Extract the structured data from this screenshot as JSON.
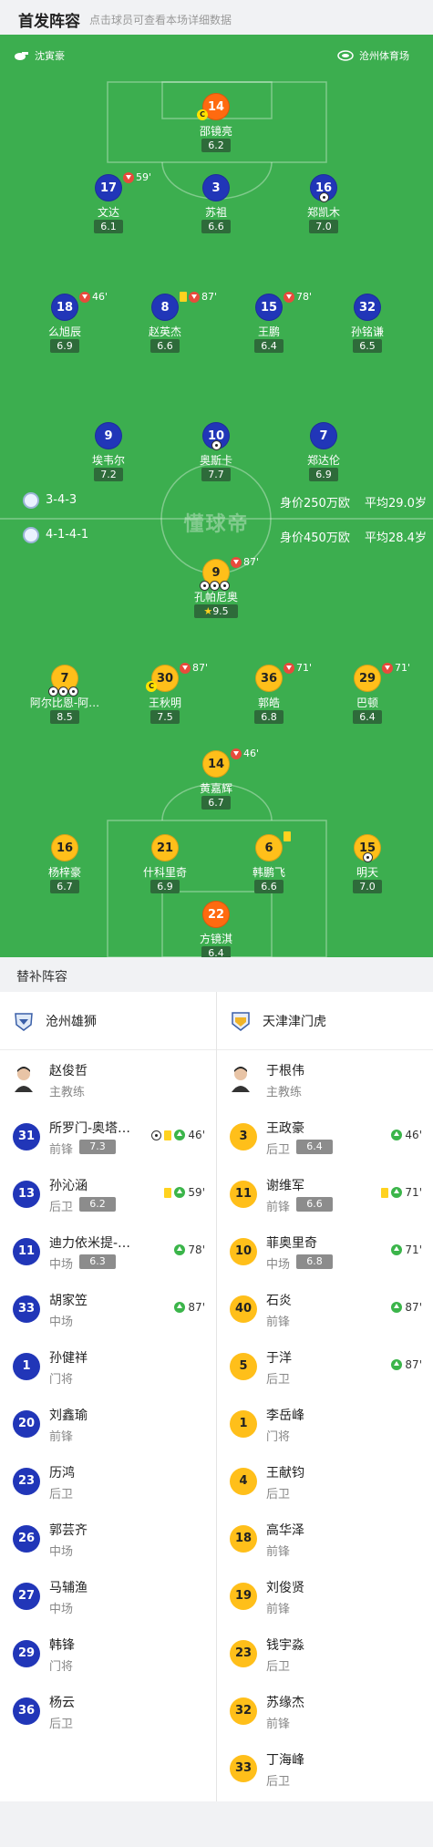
{
  "header": {
    "title": "首发阵容",
    "subtitle": "点击球员可查看本场详细数据"
  },
  "venue": {
    "referee": "沈寅豪",
    "stadium": "沧州体育场"
  },
  "watermark": "懂球帝",
  "teams_info": {
    "home": {
      "formation": "3-4-3",
      "value": "身价250万欧",
      "age": "平均29.0岁"
    },
    "away": {
      "formation": "4-1-4-1",
      "value": "身价450万欧",
      "age": "平均28.4岁"
    }
  },
  "pitch_players": [
    {
      "num": "14",
      "name": "邵镜亮",
      "rating": "6.2",
      "color": "orange",
      "captain": "C"
    },
    {
      "num": "17",
      "name": "文达",
      "rating": "6.1",
      "color": "blue",
      "sub_time": "59'"
    },
    {
      "num": "3",
      "name": "苏祖",
      "rating": "6.6",
      "color": "blue"
    },
    {
      "num": "16",
      "name": "郑凯木",
      "rating": "7.0",
      "color": "blue",
      "ball": true
    },
    {
      "num": "18",
      "name": "么旭辰",
      "rating": "6.9",
      "color": "blue",
      "sub_time": "46'"
    },
    {
      "num": "8",
      "name": "赵英杰",
      "rating": "6.6",
      "color": "blue",
      "sub_time": "87'",
      "card": true
    },
    {
      "num": "15",
      "name": "王鹏",
      "rating": "6.4",
      "color": "blue",
      "sub_time": "78'"
    },
    {
      "num": "32",
      "name": "孙铭谦",
      "rating": "6.5",
      "color": "blue"
    },
    {
      "num": "9",
      "name": "埃韦尔",
      "rating": "7.2",
      "color": "blue"
    },
    {
      "num": "10",
      "name": "奥斯卡",
      "rating": "7.7",
      "color": "blue",
      "ball": true
    },
    {
      "num": "7",
      "name": "郑达伦",
      "rating": "6.9",
      "color": "blue"
    },
    {
      "num": "9",
      "name": "孔帕尼奥",
      "rating": "9.5",
      "color": "yellow",
      "sub_time": "87'",
      "goals": 3,
      "star": true
    },
    {
      "num": "7",
      "name": "阿尔比恩-阿…",
      "rating": "8.5",
      "color": "yellow",
      "goals": 3
    },
    {
      "num": "30",
      "name": "王秋明",
      "rating": "7.5",
      "color": "yellow",
      "sub_time": "87'",
      "captain": "C"
    },
    {
      "num": "36",
      "name": "郭皓",
      "rating": "6.8",
      "color": "yellow",
      "sub_time": "71'"
    },
    {
      "num": "29",
      "name": "巴顿",
      "rating": "6.4",
      "color": "yellow",
      "sub_time": "71'"
    },
    {
      "num": "14",
      "name": "黄嘉辉",
      "rating": "6.7",
      "color": "yellow",
      "sub_time": "46'"
    },
    {
      "num": "16",
      "name": "杨梓豪",
      "rating": "6.7",
      "color": "yellow"
    },
    {
      "num": "21",
      "name": "什科里奇",
      "rating": "6.9",
      "color": "yellow"
    },
    {
      "num": "6",
      "name": "韩鹏飞",
      "rating": "6.6",
      "color": "yellow",
      "card": true
    },
    {
      "num": "15",
      "name": "明天",
      "rating": "7.0",
      "color": "yellow",
      "ball": true
    },
    {
      "num": "22",
      "name": "方镜淇",
      "rating": "6.4",
      "color": "orange"
    }
  ],
  "subs": {
    "title": "替补阵容",
    "home": {
      "team": "沧州雄狮",
      "coach": {
        "name": "赵俊哲",
        "role": "主教练"
      },
      "players": [
        {
          "num": "31",
          "name": "所罗门-奥塔…",
          "pos": "前锋",
          "rating": "7.3",
          "events": "46'",
          "ball": true,
          "card": true
        },
        {
          "num": "13",
          "name": "孙沁涵",
          "pos": "后卫",
          "rating": "6.2",
          "events": "59'",
          "card": true
        },
        {
          "num": "11",
          "name": "迪力依米提-…",
          "pos": "中场",
          "rating": "6.3",
          "events": "78'"
        },
        {
          "num": "33",
          "name": "胡家笠",
          "pos": "中场",
          "events": "87'"
        },
        {
          "num": "1",
          "name": "孙健祥",
          "pos": "门将"
        },
        {
          "num": "20",
          "name": "刘鑫瑜",
          "pos": "前锋"
        },
        {
          "num": "23",
          "name": "历鸿",
          "pos": "后卫"
        },
        {
          "num": "26",
          "name": "郭芸齐",
          "pos": "中场"
        },
        {
          "num": "27",
          "name": "马辅渔",
          "pos": "中场"
        },
        {
          "num": "29",
          "name": "韩锋",
          "pos": "门将"
        },
        {
          "num": "36",
          "name": "杨云",
          "pos": "后卫"
        }
      ]
    },
    "away": {
      "team": "天津津门虎",
      "coach": {
        "name": "于根伟",
        "role": "主教练"
      },
      "players": [
        {
          "num": "3",
          "name": "王政豪",
          "pos": "后卫",
          "rating": "6.4",
          "events": "46'"
        },
        {
          "num": "11",
          "name": "谢维军",
          "pos": "前锋",
          "rating": "6.6",
          "events": "71'",
          "card": true
        },
        {
          "num": "10",
          "name": "菲奥里奇",
          "pos": "中场",
          "rating": "6.8",
          "events": "71'"
        },
        {
          "num": "40",
          "name": "石炎",
          "pos": "前锋",
          "events": "87'"
        },
        {
          "num": "5",
          "name": "于洋",
          "pos": "后卫",
          "events": "87'"
        },
        {
          "num": "1",
          "name": "李岳峰",
          "pos": "门将"
        },
        {
          "num": "4",
          "name": "王献钧",
          "pos": "后卫"
        },
        {
          "num": "18",
          "name": "高华泽",
          "pos": "前锋"
        },
        {
          "num": "19",
          "name": "刘俊贤",
          "pos": "前锋"
        },
        {
          "num": "23",
          "name": "钱宇淼",
          "pos": "后卫"
        },
        {
          "num": "32",
          "name": "苏缘杰",
          "pos": "前锋"
        },
        {
          "num": "33",
          "name": "丁海峰",
          "pos": "后卫"
        }
      ]
    }
  }
}
